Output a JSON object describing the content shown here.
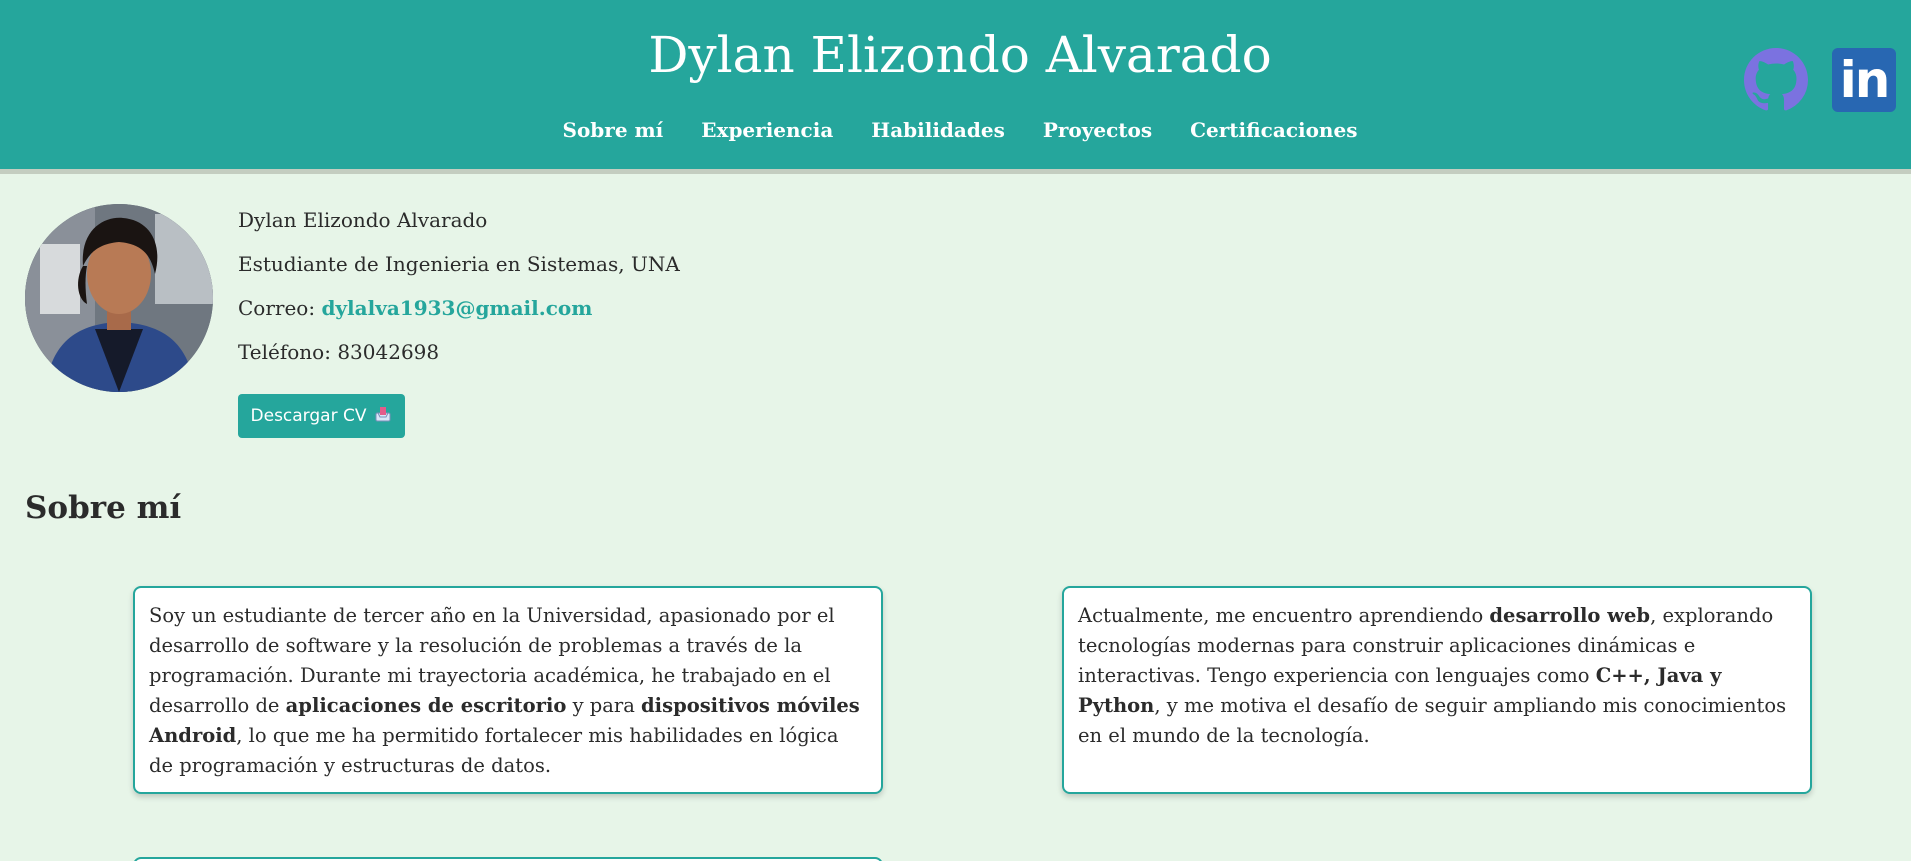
{
  "header": {
    "title": "Dylan Elizondo Alvarado",
    "nav": [
      "Sobre mí",
      "Experiencia",
      "Habilidades",
      "Proyectos",
      "Certificaciones"
    ],
    "social": [
      {
        "name": "github-icon",
        "color": "#7b72e0"
      },
      {
        "name": "linkedin-icon",
        "label": "in",
        "color": "#2867b2"
      }
    ]
  },
  "profile": {
    "name": "Dylan Elizondo Alvarado",
    "role": "Estudiante de Ingenieria en Sistemas, UNA",
    "email_label": "Correo: ",
    "email": "dylalva1933@gmail.com",
    "phone_label": "Teléfono: ",
    "phone": "83042698",
    "cv_button": "Descargar CV"
  },
  "about": {
    "title": "Sobre mí",
    "card1": {
      "t1": "Soy un estudiante de tercer año en la Universidad, apasionado por el desarrollo de software y la resolución de problemas a través de la programación. Durante mi trayectoria académica, he trabajado en el desarrollo de ",
      "b1": "aplicaciones de escritorio",
      "t2": " y para ",
      "b2": "dispositivos móviles Android",
      "t3": ", lo que me ha permitido fortalecer mis habilidades en lógica de programación y estructuras de datos."
    },
    "card2": {
      "t1": "Actualmente, me encuentro aprendiendo ",
      "b1": "desarrollo web",
      "t2": ", explorando tecnologías modernas para construir aplicaciones dinámicas e interactivas. Tengo experiencia con lenguajes como ",
      "b2": "C++, Java y Python",
      "t3": ", y me motiva el desafío de seguir ampliando mis conocimientos en el mundo de la tecnología."
    }
  },
  "colors": {
    "accent": "#25a69c",
    "background": "#e7f5e8",
    "github": "#7b72e0",
    "linkedin": "#2867b2"
  }
}
